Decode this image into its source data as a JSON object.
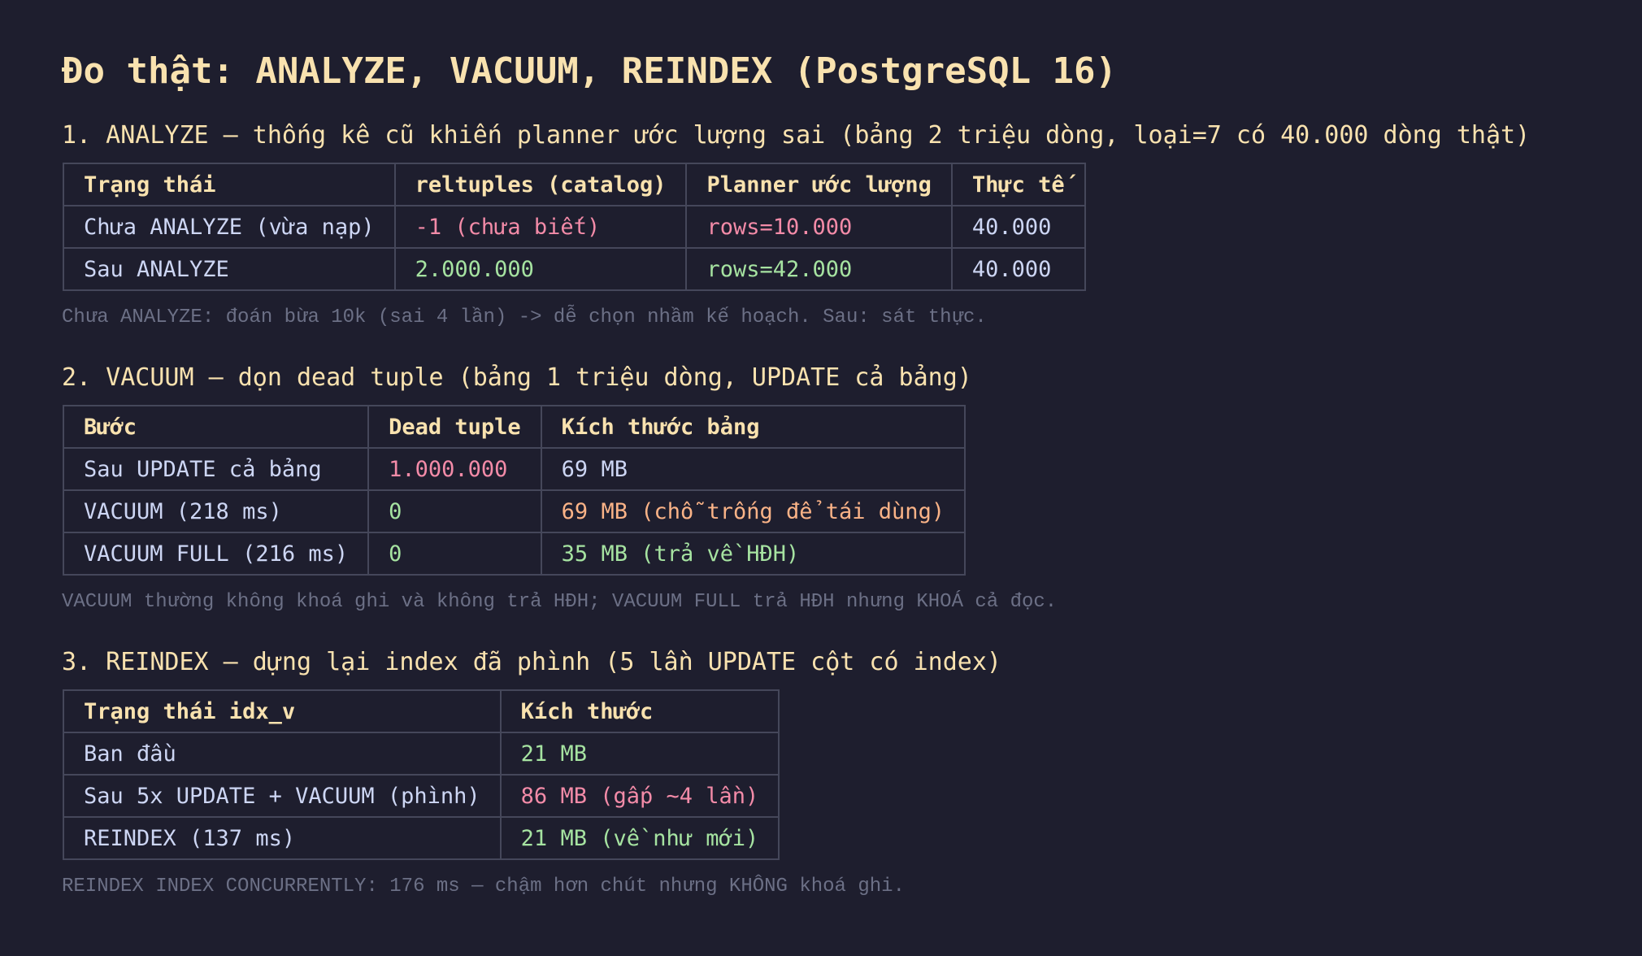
{
  "title": "Đo thật: ANALYZE, VACUUM, REINDEX (PostgreSQL 16)",
  "sections": [
    {
      "heading": "1. ANALYZE — thống kê cũ khiến planner ước lượng sai (bảng 2 triệu dòng, loại=7 có 40.000 dòng thật)",
      "columns": [
        "Trạng thái",
        "reltuples (catalog)",
        "Planner ước lượng",
        "Thực tế"
      ],
      "rows": [
        [
          "Chưa ANALYZE (vừa nạp)",
          "-1 (chưa biết)",
          "rows=10.000",
          "40.000"
        ],
        [
          "Sau ANALYZE",
          "2.000.000",
          "rows=42.000",
          "40.000"
        ]
      ],
      "note": "Chưa ANALYZE: đoán bừa 10k (sai 4 lần) -> dễ chọn nhầm kế hoạch. Sau: sát thực."
    },
    {
      "heading": "2. VACUUM — dọn dead tuple (bảng 1 triệu dòng, UPDATE cả bảng)",
      "columns": [
        "Bước",
        "Dead tuple",
        "Kích thước bảng"
      ],
      "rows": [
        [
          "Sau UPDATE cả bảng",
          "1.000.000",
          "69 MB"
        ],
        [
          "VACUUM (218 ms)",
          "0",
          "69 MB (chỗ trống để tái dùng)"
        ],
        [
          "VACUUM FULL (216 ms)",
          "0",
          "35 MB (trả về HĐH)"
        ]
      ],
      "note": "VACUUM thường không khoá ghi và không trả HĐH; VACUUM FULL trả HĐH nhưng KHOÁ cả đọc."
    },
    {
      "heading": "3. REINDEX — dựng lại index đã phình (5 lần UPDATE cột có index)",
      "columns": [
        "Trạng thái idx_v",
        "Kích thước"
      ],
      "rows": [
        [
          "Ban đầu",
          "21 MB"
        ],
        [
          "Sau 5x UPDATE + VACUUM (phình)",
          "86 MB (gấp ~4 lần)"
        ],
        [
          "REINDEX (137 ms)",
          "21 MB (về như mới)"
        ]
      ],
      "note": "REINDEX INDEX CONCURRENTLY: 176 ms — chậm hơn chút nhưng KHÔNG khoá ghi."
    }
  ],
  "colors": {
    "background": "#1e1e2e",
    "heading": "#f9e2af",
    "text": "#cdd6f4",
    "bad": "#f38ba8",
    "good": "#a6e3a1",
    "warn": "#fab387",
    "note": "#6c7086",
    "border": "#45475a"
  }
}
